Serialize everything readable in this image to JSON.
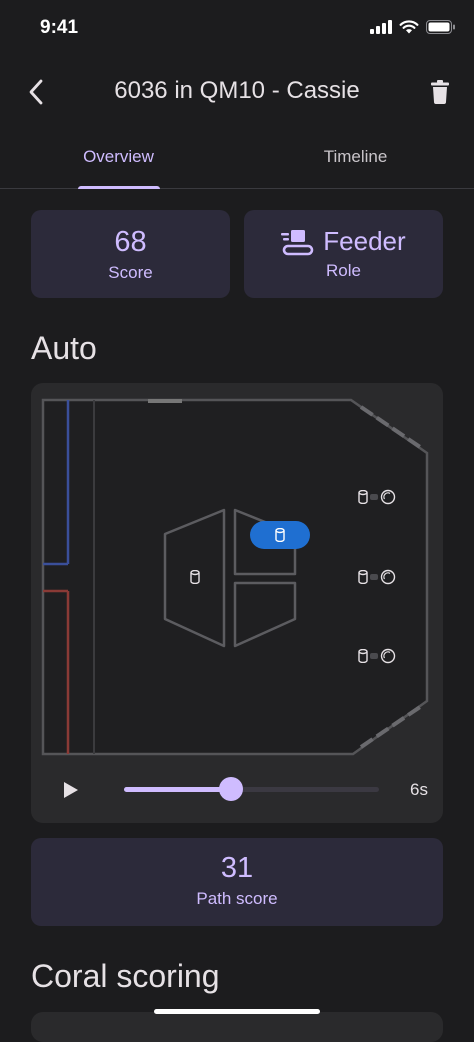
{
  "status_bar": {
    "time": "9:41"
  },
  "app_bar": {
    "title": "6036 in QM10 - Cassie"
  },
  "tabs": [
    {
      "label": "Overview",
      "selected": true
    },
    {
      "label": "Timeline",
      "selected": false
    }
  ],
  "stats": {
    "score": {
      "value": "68",
      "label": "Score"
    },
    "role": {
      "value": "Feeder",
      "label": "Role"
    }
  },
  "auto": {
    "title": "Auto",
    "playback": {
      "time_label": "6s",
      "progress": 0.42
    }
  },
  "path_score": {
    "value": "31",
    "label": "Path score"
  },
  "coral": {
    "title": "Coral scoring"
  },
  "colors": {
    "accent": "#cfbcff",
    "card": "#2c2a3a",
    "background": "#1c1c1e",
    "robot": "#1f6fd1",
    "blue_alliance": "#3a4f9a",
    "red_alliance": "#8a3a36"
  },
  "icons": [
    "chevron-left-icon",
    "trash-icon",
    "play-icon",
    "feeder-icon",
    "coral-icon",
    "algae-icon"
  ]
}
